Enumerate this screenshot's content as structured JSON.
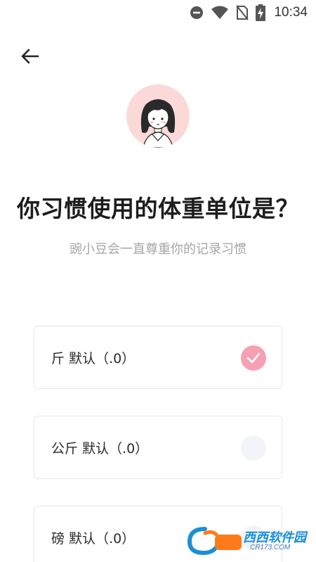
{
  "status_bar": {
    "time": "10:34",
    "icons": [
      "do-not-disturb-icon",
      "wifi-icon",
      "no-sim-icon",
      "battery-charging-icon"
    ]
  },
  "header": {
    "back_icon": "arrow-left-icon"
  },
  "avatar": {
    "icon": "girl-avatar-icon",
    "background": "#fbd9d9"
  },
  "page": {
    "title": "你习惯使用的体重单位是？",
    "subtitle": "豌小豆会一直尊重你的记录习惯"
  },
  "options": [
    {
      "label": "斤  默认（.0）",
      "selected": true
    },
    {
      "label": "公斤  默认（.0）",
      "selected": false
    },
    {
      "label": "磅  默认（.0）",
      "selected": false
    }
  ],
  "watermark": {
    "name": "西西软件园",
    "url": "CR173.COM"
  },
  "colors": {
    "accent": "#f5a0b3",
    "avatar_bg": "#fbd9d9",
    "radio_off": "#f3f4f9"
  }
}
